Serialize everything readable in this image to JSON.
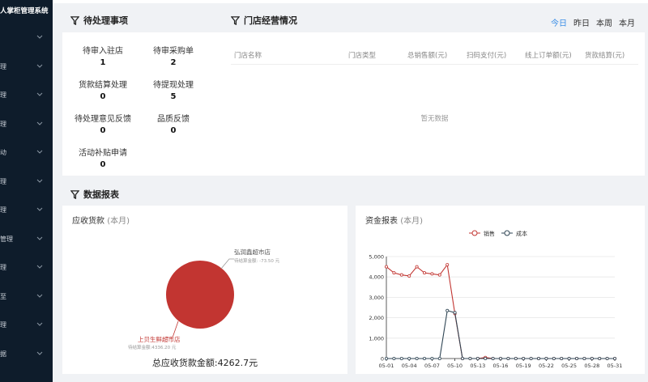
{
  "sidebar": {
    "title": "人掌柜管理系统",
    "items": [
      {
        "label": ""
      },
      {
        "label": "理"
      },
      {
        "label": "理"
      },
      {
        "label": "理"
      },
      {
        "label": "动"
      },
      {
        "label": "理"
      },
      {
        "label": "理"
      },
      {
        "label": "管理"
      },
      {
        "label": "理"
      },
      {
        "label": "至"
      },
      {
        "label": "理"
      },
      {
        "label": "据"
      }
    ]
  },
  "todo": {
    "title": "待处理事项",
    "items": [
      {
        "label": "待审入驻店",
        "count": "1"
      },
      {
        "label": "待审采购单",
        "count": "2"
      },
      {
        "label": "货款结算处理",
        "count": "0"
      },
      {
        "label": "待提现处理",
        "count": "5"
      },
      {
        "label": "待处理意见反馈",
        "count": "0"
      },
      {
        "label": "品质反馈",
        "count": "0"
      },
      {
        "label": "活动补贴申请",
        "count": "0"
      }
    ]
  },
  "store": {
    "title": "门店经营情况",
    "tabs": [
      "今日",
      "昨日",
      "本周",
      "本月"
    ],
    "active_tab": "今日",
    "columns": [
      "门店名称",
      "门店类型",
      "总销售额(元)",
      "扫码支付(元)",
      "线上订单额(元)",
      "货款结算(元)"
    ],
    "empty_text": "暂无数据"
  },
  "report": {
    "title": "数据报表"
  },
  "receivable": {
    "title": "应收货款",
    "period": "(本月)",
    "total_label": "总应收货款金额:4262.7元",
    "colors": {
      "slice": "#c23531"
    },
    "slices": [
      {
        "name": "弘润鑫超市店",
        "sub": "待结算金额: -73.50 元",
        "value": -73.5
      },
      {
        "name": "上贝生鲜超市店",
        "sub": "待结算金额:4336.20 元",
        "value": 4336.2
      }
    ]
  },
  "funds": {
    "title": "资金报表",
    "period": "(本月)"
  },
  "chart_data": {
    "type": "line",
    "legend": [
      "销售",
      "成本"
    ],
    "colors": [
      "#c23531",
      "#2f4554"
    ],
    "x": [
      "05-01",
      "05-02",
      "05-03",
      "05-04",
      "05-05",
      "05-06",
      "05-07",
      "05-08",
      "05-09",
      "05-10",
      "05-11",
      "05-12",
      "05-13",
      "05-14",
      "05-15",
      "05-16",
      "05-17",
      "05-18",
      "05-19",
      "05-20",
      "05-21",
      "05-22",
      "05-23",
      "05-24",
      "05-25",
      "05-26",
      "05-27",
      "05-28",
      "05-29",
      "05-30",
      "05-31"
    ],
    "x_ticks": [
      "05-01",
      "05-04",
      "05-07",
      "05-10",
      "05-13",
      "05-16",
      "05-19",
      "05-22",
      "05-25",
      "05-28",
      "05-31"
    ],
    "y_ticks": [
      "0",
      "1,000",
      "2,000",
      "3,000",
      "4,000",
      "5,000"
    ],
    "ylim": [
      0,
      5000
    ],
    "series": [
      {
        "name": "销售",
        "values": [
          4500,
          4200,
          4100,
          4050,
          4500,
          4200,
          4150,
          4100,
          4600,
          2200,
          0,
          0,
          0,
          50,
          0,
          0,
          0,
          0,
          0,
          0,
          0,
          0,
          0,
          0,
          0,
          0,
          0,
          0,
          0,
          0,
          0
        ]
      },
      {
        "name": "成本",
        "values": [
          0,
          0,
          0,
          0,
          0,
          0,
          0,
          0,
          2350,
          2250,
          0,
          0,
          0,
          0,
          0,
          0,
          0,
          0,
          0,
          0,
          0,
          0,
          0,
          0,
          0,
          0,
          0,
          0,
          0,
          0,
          0
        ]
      }
    ],
    "legend_position": "top"
  }
}
